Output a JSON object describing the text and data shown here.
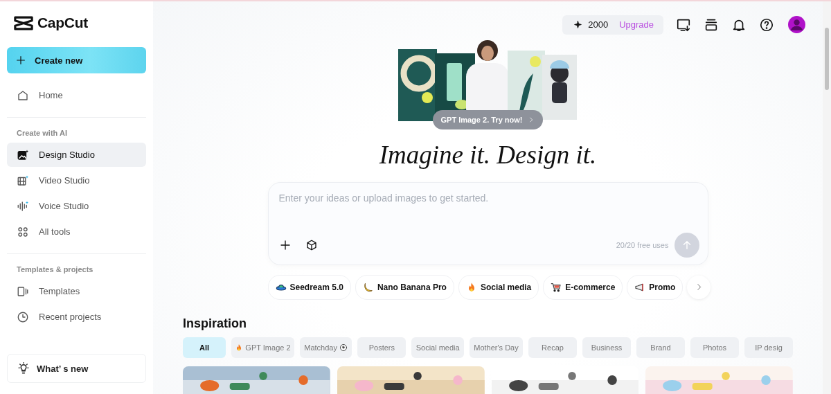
{
  "header": {
    "logo": "CapCut",
    "credits": "2000",
    "upgrade": "Upgrade"
  },
  "sidebar": {
    "create_button": "Create new",
    "items": [
      {
        "label": "Home",
        "selected": false
      }
    ],
    "sections": [
      {
        "title": "Create with AI",
        "items": [
          {
            "label": "Design Studio",
            "selected": true
          },
          {
            "label": "Video Studio",
            "selected": false
          },
          {
            "label": "Voice Studio",
            "selected": false
          },
          {
            "label": "All tools",
            "selected": false
          }
        ]
      },
      {
        "title": "Templates & projects",
        "items": [
          {
            "label": "Templates",
            "selected": false
          },
          {
            "label": "Recent projects",
            "selected": false
          }
        ]
      }
    ],
    "whats_new": "What’ s new"
  },
  "hero": {
    "badge": "GPT Image 2. Try now!",
    "headline": "Imagine it. Design it.",
    "prompt": {
      "placeholder": "Enter your ideas or upload images to get started.",
      "uses": "20/20 free uses"
    },
    "chips": [
      {
        "label": "Seedream 5.0"
      },
      {
        "label": "Nano Banana Pro"
      },
      {
        "label": "Social media"
      },
      {
        "label": "E-commerce"
      },
      {
        "label": "Promo"
      }
    ]
  },
  "inspiration": {
    "title": "Inspiration",
    "filters": [
      {
        "label": "All",
        "selected": true
      },
      {
        "label": "GPT Image 2",
        "selected": false
      },
      {
        "label": "Matchday",
        "selected": false
      },
      {
        "label": "Posters",
        "selected": false
      },
      {
        "label": "Social media",
        "selected": false
      },
      {
        "label": "Mother's Day",
        "selected": false
      },
      {
        "label": "Recap",
        "selected": false
      },
      {
        "label": "Business",
        "selected": false
      },
      {
        "label": "Brand",
        "selected": false
      },
      {
        "label": "Photos",
        "selected": false
      },
      {
        "label": "IP desig",
        "selected": false
      }
    ]
  }
}
